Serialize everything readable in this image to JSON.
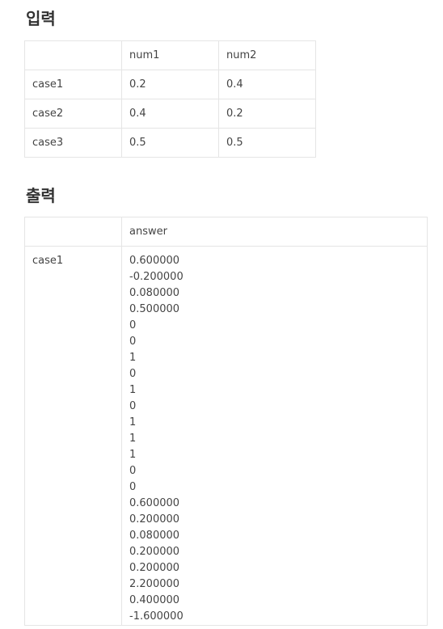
{
  "input_section": {
    "title": "입력",
    "header": [
      "",
      "num1",
      "num2"
    ],
    "rows": [
      [
        "case1",
        "0.2",
        "0.4"
      ],
      [
        "case2",
        "0.4",
        "0.2"
      ],
      [
        "case3",
        "0.5",
        "0.5"
      ]
    ]
  },
  "output_section": {
    "title": "출력",
    "header": [
      "",
      "answer"
    ],
    "rows": [
      {
        "case": "case1",
        "answer_lines": [
          "0.600000",
          "-0.200000",
          "0.080000",
          "0.500000",
          "0",
          "0",
          "1",
          "0",
          "1",
          "0",
          "1",
          "1",
          "1",
          "0",
          "0",
          "0.600000",
          "0.200000",
          "0.080000",
          "0.200000",
          "0.200000",
          "2.200000",
          "0.400000",
          "-1.600000"
        ]
      }
    ]
  }
}
